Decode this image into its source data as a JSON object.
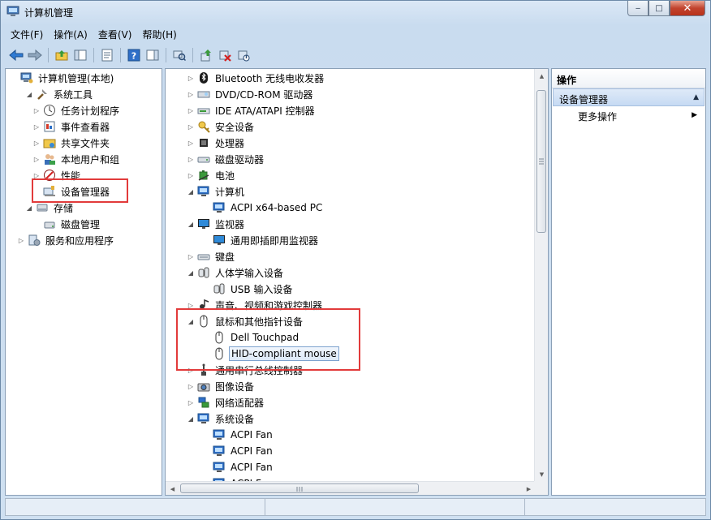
{
  "window": {
    "title": "计算机管理",
    "controls": {
      "minimize": "‒",
      "maximize": "□",
      "close": "✕"
    }
  },
  "menu": [
    "文件(F)",
    "操作(A)",
    "查看(V)",
    "帮助(H)"
  ],
  "left_tree": [
    {
      "label": "计算机管理(本地)",
      "icon": "computer-management-icon",
      "twisty": ""
    },
    {
      "label": "系统工具",
      "icon": "system-tools-icon",
      "twisty": "◢"
    },
    {
      "label": "任务计划程序",
      "icon": "task-scheduler-icon",
      "twisty": "▷"
    },
    {
      "label": "事件查看器",
      "icon": "event-viewer-icon",
      "twisty": "▷"
    },
    {
      "label": "共享文件夹",
      "icon": "shared-folder-icon",
      "twisty": "▷"
    },
    {
      "label": "本地用户和组",
      "icon": "users-icon",
      "twisty": "▷"
    },
    {
      "label": "性能",
      "icon": "performance-icon",
      "twisty": "▷"
    },
    {
      "label": "设备管理器",
      "icon": "device-manager-icon",
      "twisty": ""
    },
    {
      "label": "存储",
      "icon": "storage-icon",
      "twisty": "◢"
    },
    {
      "label": "磁盘管理",
      "icon": "disk-management-icon",
      "twisty": ""
    },
    {
      "label": "服务和应用程序",
      "icon": "services-icon",
      "twisty": "▷"
    }
  ],
  "device_tree": [
    {
      "label": "Bluetooth 无线电收发器",
      "icon": "bluetooth-icon",
      "twisty": "▷"
    },
    {
      "label": "DVD/CD-ROM 驱动器",
      "icon": "dvd-drive-icon",
      "twisty": "▷"
    },
    {
      "label": "IDE ATA/ATAPI 控制器",
      "icon": "ide-controller-icon",
      "twisty": "▷"
    },
    {
      "label": "安全设备",
      "icon": "security-device-icon",
      "twisty": "▷"
    },
    {
      "label": "处理器",
      "icon": "processor-icon",
      "twisty": "▷"
    },
    {
      "label": "磁盘驱动器",
      "icon": "disk-drive-icon",
      "twisty": "▷"
    },
    {
      "label": "电池",
      "icon": "battery-icon",
      "twisty": "▷"
    },
    {
      "label": "计算机",
      "icon": "computer-icon",
      "twisty": "◢"
    },
    {
      "label": "ACPI x64-based PC",
      "icon": "computer-icon",
      "twisty": ""
    },
    {
      "label": "监视器",
      "icon": "monitor-icon",
      "twisty": "◢"
    },
    {
      "label": "通用即插即用监视器",
      "icon": "monitor-icon",
      "twisty": ""
    },
    {
      "label": "键盘",
      "icon": "keyboard-icon",
      "twisty": "▷"
    },
    {
      "label": "人体学输入设备",
      "icon": "hid-icon",
      "twisty": "◢"
    },
    {
      "label": "USB 输入设备",
      "icon": "hid-icon",
      "twisty": ""
    },
    {
      "label": "声音、视频和游戏控制器",
      "icon": "sound-icon",
      "twisty": "▷"
    },
    {
      "label": "鼠标和其他指针设备",
      "icon": "mouse-icon",
      "twisty": "◢"
    },
    {
      "label": "Dell Touchpad",
      "icon": "mouse-icon",
      "twisty": ""
    },
    {
      "label": "HID-compliant mouse",
      "icon": "mouse-icon",
      "twisty": ""
    },
    {
      "label": "通用串行总线控制器",
      "icon": "usb-controller-icon",
      "twisty": "▷"
    },
    {
      "label": "图像设备",
      "icon": "camera-icon",
      "twisty": "▷"
    },
    {
      "label": "网络适配器",
      "icon": "network-adapter-icon",
      "twisty": "▷"
    },
    {
      "label": "系统设备",
      "icon": "computer-icon",
      "twisty": "◢"
    },
    {
      "label": "ACPI Fan",
      "icon": "system-device-icon",
      "twisty": ""
    },
    {
      "label": "ACPI Fan",
      "icon": "system-device-icon",
      "twisty": ""
    },
    {
      "label": "ACPI Fan",
      "icon": "system-device-icon",
      "twisty": ""
    },
    {
      "label": "ACPI F...",
      "icon": "system-device-icon",
      "twisty": ""
    }
  ],
  "actions": {
    "header": "操作",
    "section": "设备管理器",
    "more": "更多操作"
  },
  "colors": {
    "highlight": "#e23b3b",
    "selection": "#dde9f8"
  }
}
